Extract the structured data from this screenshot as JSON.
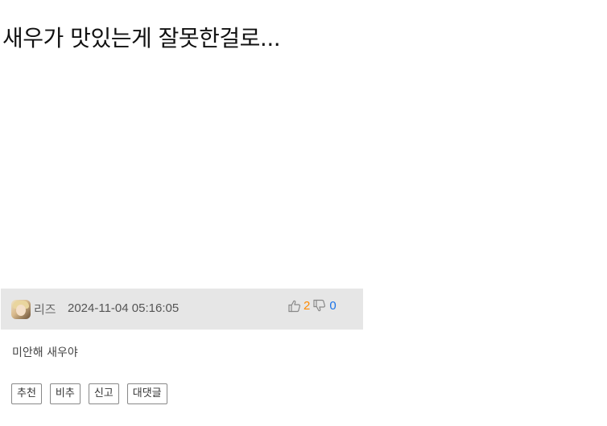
{
  "post": {
    "title": "새우가 맛있는게 잘못한걸로..."
  },
  "comment": {
    "author": "리즈",
    "datetime": "2024-11-04 05:16:05",
    "upvotes": "2",
    "downvotes": "0",
    "text": "미안해 새우야",
    "actions": {
      "recommend": "추천",
      "not_recommend": "비추",
      "report": "신고",
      "reply": "대댓글"
    }
  },
  "colors": {
    "header_bg": "#e6e6e6",
    "upvote": "#ff8a00",
    "downvote": "#1a73e8"
  }
}
